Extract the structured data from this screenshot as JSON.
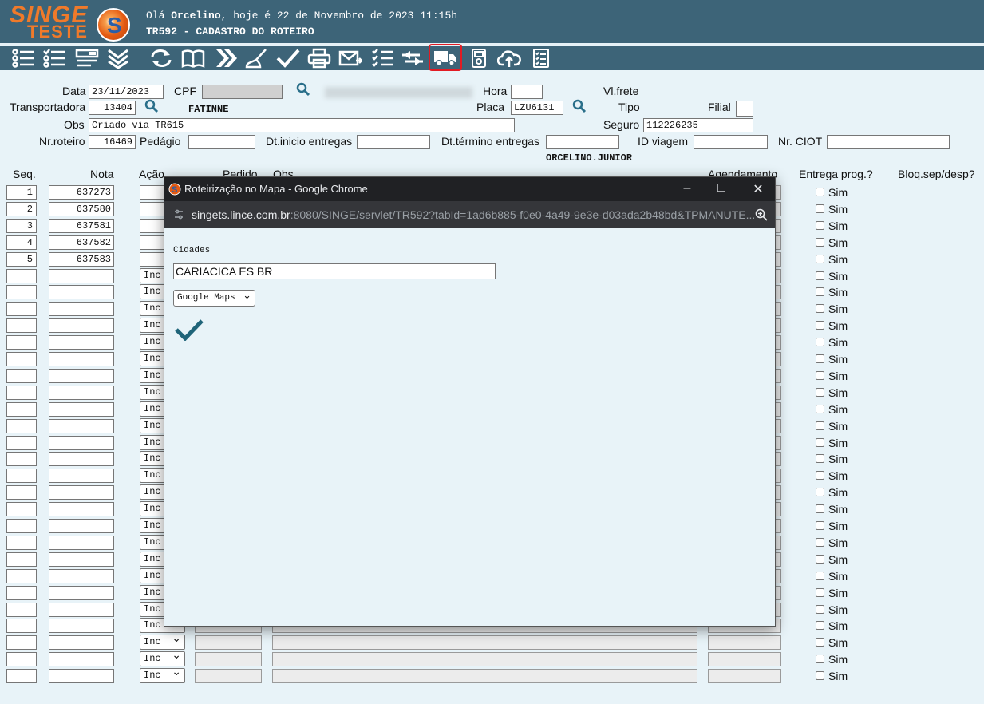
{
  "header": {
    "logo_line1": "SINGE",
    "logo_line2": "TESTE",
    "logo_badge": "S",
    "greeting_prefix": "Olá ",
    "user": "Orcelino",
    "greeting_suffix": ", hoje é 22 de Novembro de 2023 11:15h",
    "screen_title": "TR592 - CADASTRO DO ROTEIRO"
  },
  "toolbar": {
    "icons": [
      "list-numbered-icon",
      "list-check-icon",
      "form-icon",
      "double-chevron-down-icon",
      "refresh-icon",
      "book-icon",
      "double-chevron-right-icon",
      "broom-icon",
      "checkmark-icon",
      "print-icon",
      "email-send-icon",
      "checklist-icon",
      "transfer-icon",
      "truck-icon",
      "archive-box-icon",
      "cloud-upload-icon",
      "clipboard-list-icon"
    ],
    "highlighted": "truck-icon"
  },
  "form": {
    "data_label": "Data",
    "data_value": "23/11/2023",
    "cpf_label": "CPF",
    "cpf_value": "",
    "hora_label": "Hora",
    "hora_value": "",
    "vlfrete_label": "Vl.frete",
    "transportadora_label": "Transportadora",
    "transportadora_value": "13404",
    "transportadora_name": "FATINNE",
    "placa_label": "Placa",
    "placa_value": "LZU6131",
    "tipo_label": "Tipo",
    "filial_label": "Filial",
    "filial_value": "",
    "obs_label": "Obs",
    "obs_value": "Criado via TR615",
    "seguro_label": "Seguro",
    "seguro_value": "112226235",
    "nroteiro_label": "Nr.roteiro",
    "nroteiro_value": "16469",
    "pedagio_label": "Pedágio",
    "pedagio_value": "",
    "dtinicio_label": "Dt.inicio entregas",
    "dtinicio_value": "",
    "dttermino_label": "Dt.término entregas",
    "dttermino_value": "",
    "idviagem_label": "ID viagem",
    "idviagem_value": "",
    "nrciot_label": "Nr. CIOT",
    "nrciot_value": "",
    "responsavel": "ORCELINO.JUNIOR"
  },
  "table": {
    "headers": {
      "seq": "Seq.",
      "nota": "Nota",
      "acao": "Ação",
      "pedido": "Pedido",
      "obs": "Obs",
      "agendamento": "Agendamento",
      "entrega": "Entrega prog.?",
      "bloq": "Bloq.sep/desp?"
    },
    "rows_filled": [
      {
        "seq": "1",
        "nota": "637273"
      },
      {
        "seq": "2",
        "nota": "637580"
      },
      {
        "seq": "3",
        "nota": "637581"
      },
      {
        "seq": "4",
        "nota": "637582"
      },
      {
        "seq": "5",
        "nota": "637583"
      }
    ],
    "acao_option": "Inc",
    "sim_label": "Sim"
  },
  "popup": {
    "title": "Roteirização no Mapa - Google Chrome",
    "url_host": "singets.lince.com.br",
    "url_rest": ":8080/SINGE/servlet/TR592?tabId=1ad6b885-f0e0-4a49-9e3e-d03ada2b48bd&TPMANUTE...",
    "cidades_label": "Cidades",
    "cidades_value": "CARIACICA ES BR",
    "map_select": "Google Maps"
  }
}
